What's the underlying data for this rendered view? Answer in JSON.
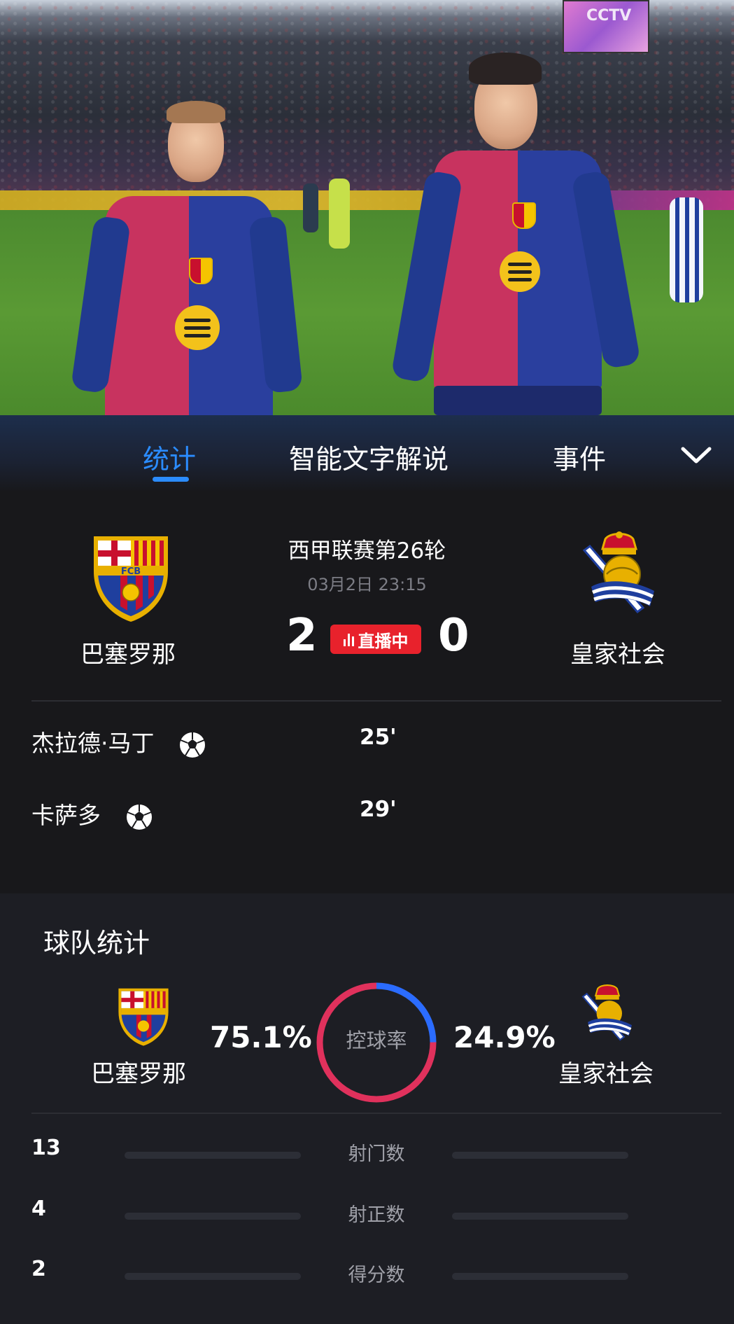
{
  "video": {
    "broadcast_watermark": "CCTV"
  },
  "tabs": [
    {
      "label": "统计",
      "active": true
    },
    {
      "label": "智能文字解说",
      "active": false
    },
    {
      "label": "事件",
      "active": false
    }
  ],
  "match": {
    "league_round": "西甲联赛第26轮",
    "datetime": "03月2日 23:15",
    "home": {
      "name": "巴塞罗那",
      "score": "2"
    },
    "away": {
      "name": "皇家社会",
      "score": "0"
    },
    "status": "直播中"
  },
  "goals": [
    {
      "player": "杰拉德·马丁",
      "minute": "25'"
    },
    {
      "player": "卡萨多",
      "minute": "29'"
    }
  ],
  "team_stats": {
    "title": "球队统计",
    "possession": {
      "label": "控球率",
      "home_pct": "75.1%",
      "away_pct": "24.9%",
      "home_value": 75.1,
      "away_value": 24.9
    },
    "home_name": "巴塞罗那",
    "away_name": "皇家社会",
    "rows": [
      {
        "label": "射门数",
        "home": "13"
      },
      {
        "label": "射正数",
        "home": "4"
      },
      {
        "label": "得分数",
        "home": "2"
      }
    ]
  },
  "colors": {
    "accent": "#2b8cff",
    "home": "#e0315c",
    "away": "#2b6cff",
    "live": "#e8222c"
  },
  "icons": [
    "chevron-down-icon",
    "soccer-ball-icon",
    "live-bars-icon",
    "barcelona-crest",
    "real-sociedad-crest"
  ]
}
